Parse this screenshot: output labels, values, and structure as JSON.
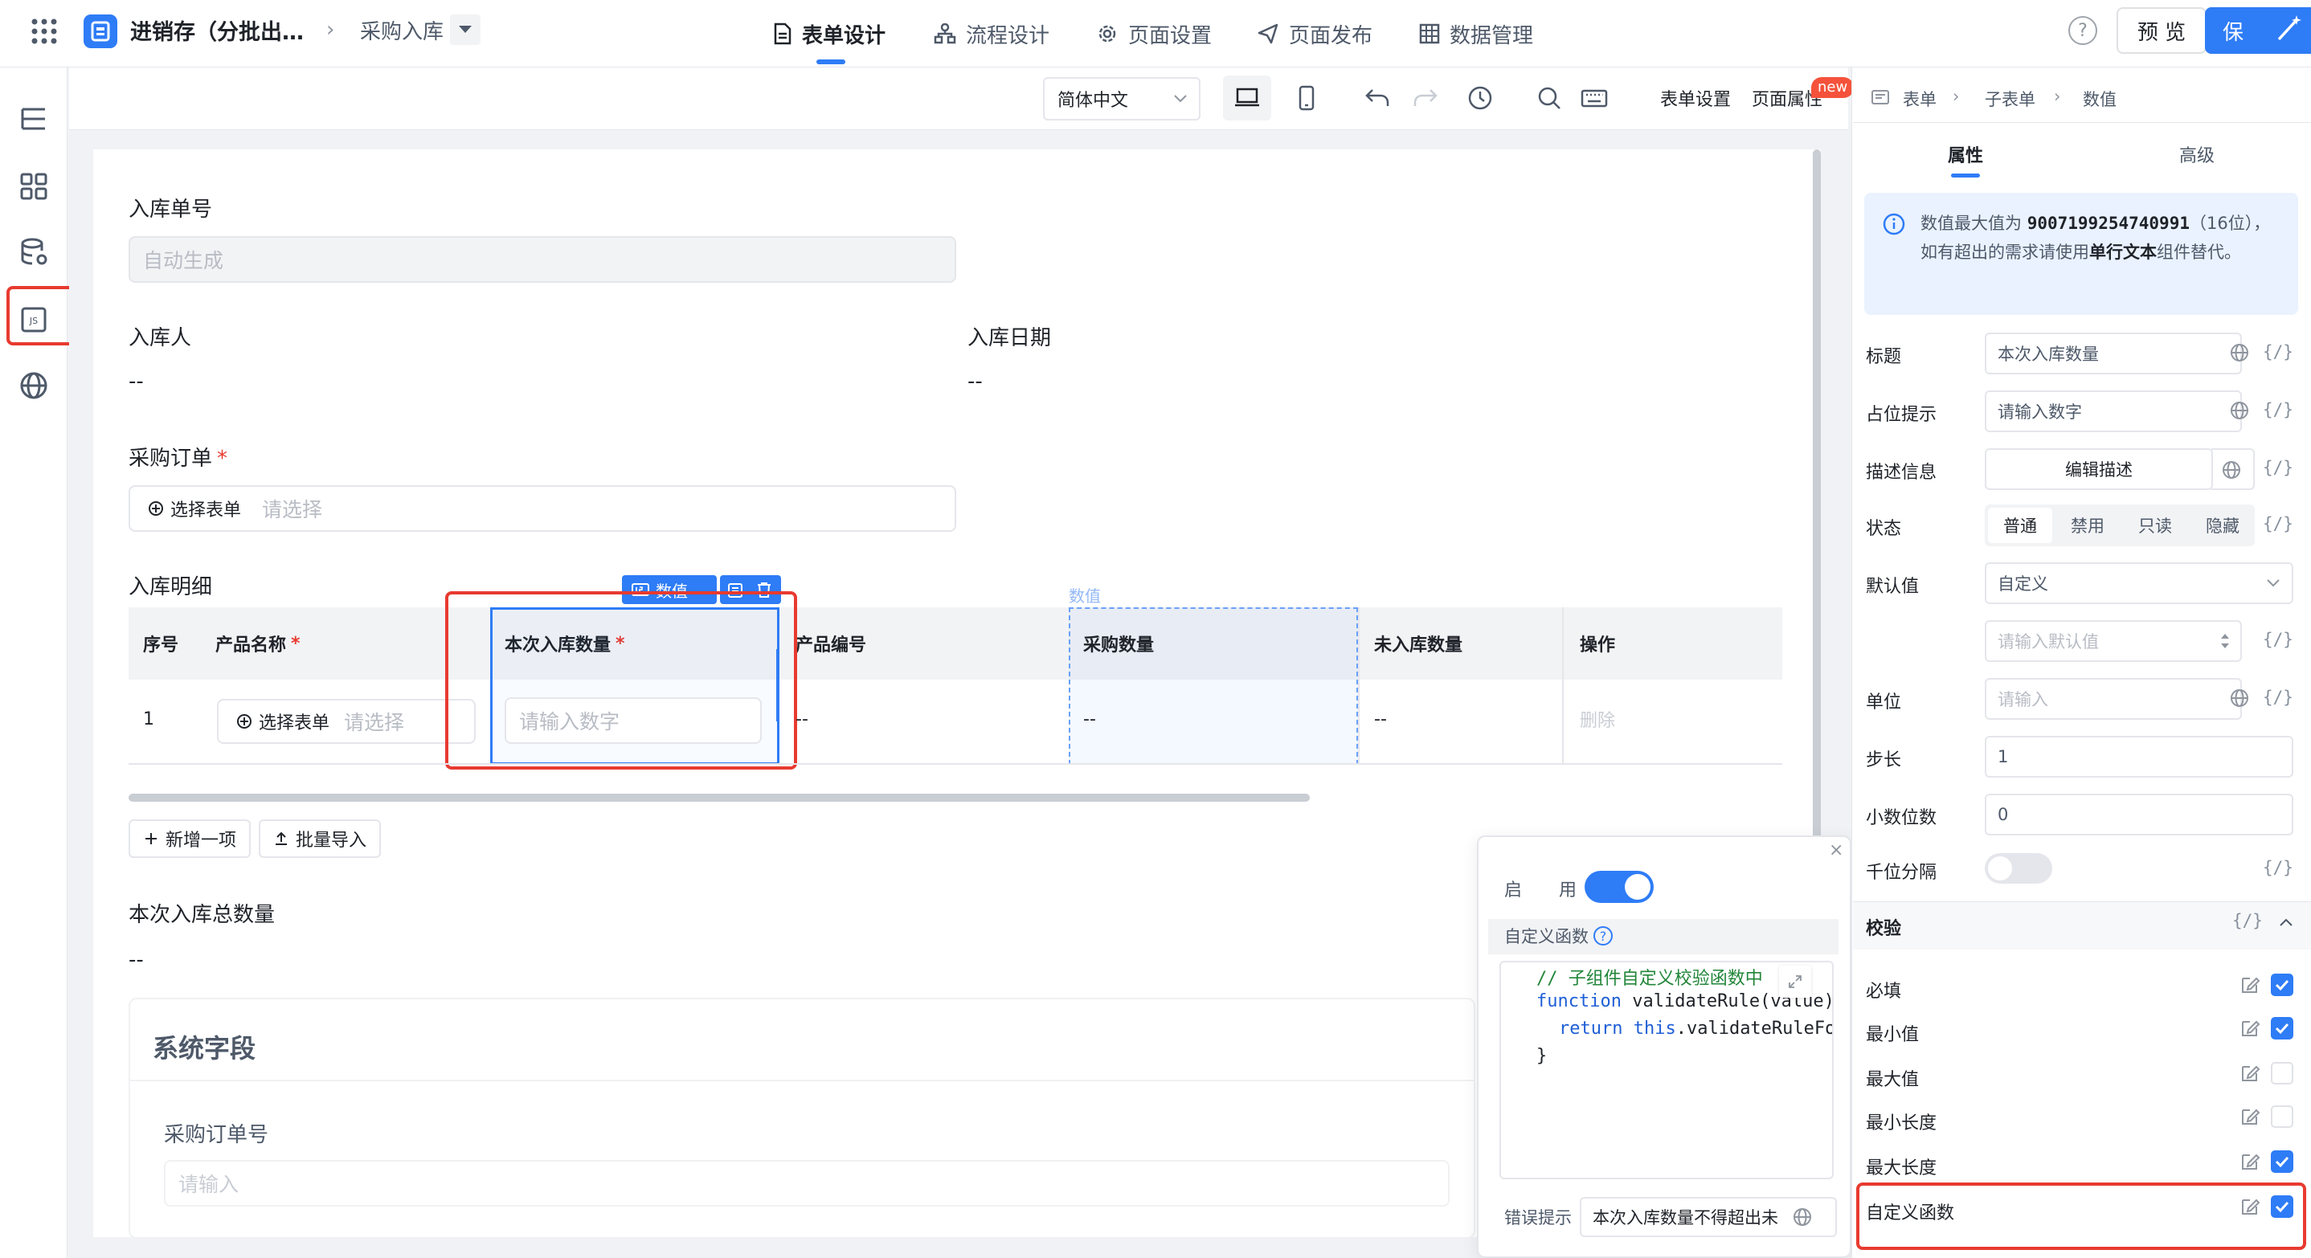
{
  "header": {
    "app_title": "进销存（分批出…",
    "page_name": "采购入库",
    "tabs": [
      {
        "label": "表单设计"
      },
      {
        "label": "流程设计"
      },
      {
        "label": "页面设置"
      },
      {
        "label": "页面发布"
      },
      {
        "label": "数据管理"
      }
    ],
    "help": "?",
    "preview_label": "预 览",
    "save_label": "保"
  },
  "toolbar": {
    "language": "简体中文",
    "form_settings": "表单设置",
    "page_props": "页面属性",
    "new_badge": "new"
  },
  "form": {
    "receipt_no": {
      "label": "入库单号",
      "placeholder": "自动生成"
    },
    "receiver": {
      "label": "入库人",
      "value": "--"
    },
    "receipt_date": {
      "label": "入库日期",
      "value": "--"
    },
    "purchase_order": {
      "label": "采购订单",
      "required": "*",
      "pick_label": "选择表单",
      "placeholder": "请选择"
    },
    "detail": {
      "label": "入库明细",
      "columns": [
        "序号",
        "产品名称",
        "本次入库数量",
        "产品编号",
        "采购数量",
        "未入库数量",
        "操作"
      ],
      "required": "*",
      "row": {
        "index": "1",
        "pick_label": "选择表单",
        "pick_placeholder": "请选择",
        "qty_placeholder": "请输入数字",
        "product_code": "--",
        "purchase_qty": "--",
        "pending_qty": "--",
        "delete": "删除"
      },
      "selected_tag": "数值",
      "hover_tag": "数值",
      "add_label": "新增一项",
      "import_label": "批量导入"
    },
    "total_qty": {
      "label": "本次入库总数量",
      "value": "--"
    },
    "system": {
      "title": "系统字段",
      "po_no_label": "采购订单号",
      "po_no_placeholder": "请输入"
    }
  },
  "popup": {
    "enable_label_1": "启",
    "enable_label_2": "用",
    "custom_fn_label": "自定义函数",
    "help": "?",
    "code": {
      "line1": "// 子组件自定义校验函数中",
      "line2_kw": "function",
      "line2_rest": " validateRule(value)",
      "line3_kw1": "return",
      "line3_kw2": " this",
      "line3_rest": ".validateRuleFo",
      "line4": "}"
    },
    "error_label": "错误提示",
    "error_value": "本次入库数量不得超出未"
  },
  "panel": {
    "breadcrumb": [
      "表单",
      "子表单",
      "数值"
    ],
    "tabs": [
      "属性",
      "高级"
    ],
    "info": {
      "prefix": "数值最大值为 ",
      "number": "9007199254740991",
      "suffix": "（16位），如有超出的需求请使用",
      "strong": "单行文本",
      "tail": "组件替代。"
    },
    "title": {
      "label": "标题",
      "value": "本次入库数量"
    },
    "placeholder": {
      "label": "占位提示",
      "value": "请输入数字"
    },
    "description": {
      "label": "描述信息",
      "button": "编辑描述"
    },
    "state": {
      "label": "状态",
      "options": [
        "普通",
        "禁用",
        "只读",
        "隐藏"
      ],
      "selected": "普通"
    },
    "default": {
      "label": "默认值",
      "mode": "自定义",
      "placeholder": "请输入默认值"
    },
    "unit": {
      "label": "单位",
      "placeholder": "请输入"
    },
    "step": {
      "label": "步长",
      "value": "1"
    },
    "decimals": {
      "label": "小数位数",
      "value": "0"
    },
    "thousands": {
      "label": "千位分隔"
    },
    "expr": "{/}",
    "validation": {
      "label": "校验",
      "rules": [
        {
          "label": "必填",
          "checked": true
        },
        {
          "label": "最小值",
          "checked": true
        },
        {
          "label": "最大值",
          "checked": false
        },
        {
          "label": "最小长度",
          "checked": false
        },
        {
          "label": "最大长度",
          "checked": true
        },
        {
          "label": "自定义函数",
          "checked": true
        }
      ]
    }
  },
  "colors": {
    "accent": "#2e7cf6",
    "highlight": "#e83a30"
  }
}
